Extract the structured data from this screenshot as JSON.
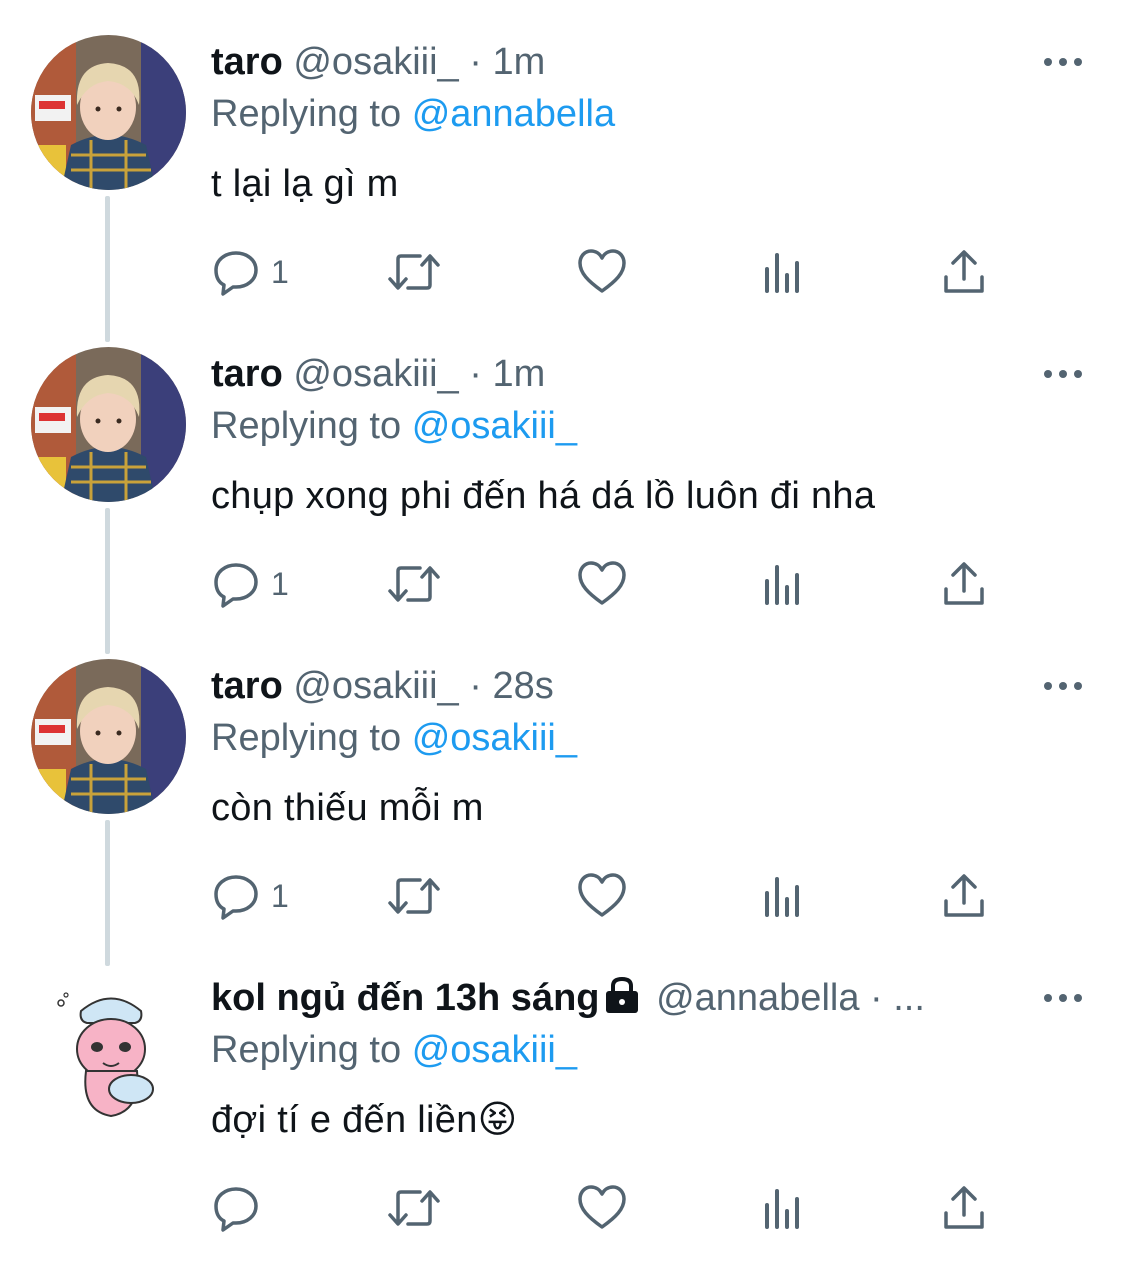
{
  "tweets": [
    {
      "name": "taro",
      "handle": "@osakiii_",
      "separator": "·",
      "time": "1m",
      "reply_prefix": "Replying to",
      "reply_to": "@annabella",
      "text": "t lại lạ gì m",
      "reply_count": "1",
      "avatar_icon": "profile-photo-blond-person"
    },
    {
      "name": "taro",
      "handle": "@osakiii_",
      "separator": "·",
      "time": "1m",
      "reply_prefix": "Replying to",
      "reply_to": "@osakiii_",
      "text": "chụp xong phi đến há dá lồ luôn đi nha",
      "reply_count": "1",
      "avatar_icon": "profile-photo-blond-person"
    },
    {
      "name": "taro",
      "handle": "@osakiii_",
      "separator": "·",
      "time": "28s",
      "reply_prefix": "Replying to",
      "reply_to": "@osakiii_",
      "text": "còn thiếu mỗi m",
      "reply_count": "1",
      "avatar_icon": "profile-photo-blond-person"
    },
    {
      "name": "kol ngủ đến 13h sáng",
      "handle": "@annabella",
      "separator": "· ...",
      "time": "",
      "reply_prefix": "Replying to",
      "reply_to": "@osakiii_",
      "text": "đợi tí e đến liền😝",
      "reply_count": "",
      "avatar_icon": "pink-sleepy-character-with-pillow",
      "protected": true
    }
  ],
  "colors": {
    "link": "#1d9bf0",
    "secondary": "#536471",
    "text": "#0f1419",
    "thread_line": "#cfd9de"
  }
}
